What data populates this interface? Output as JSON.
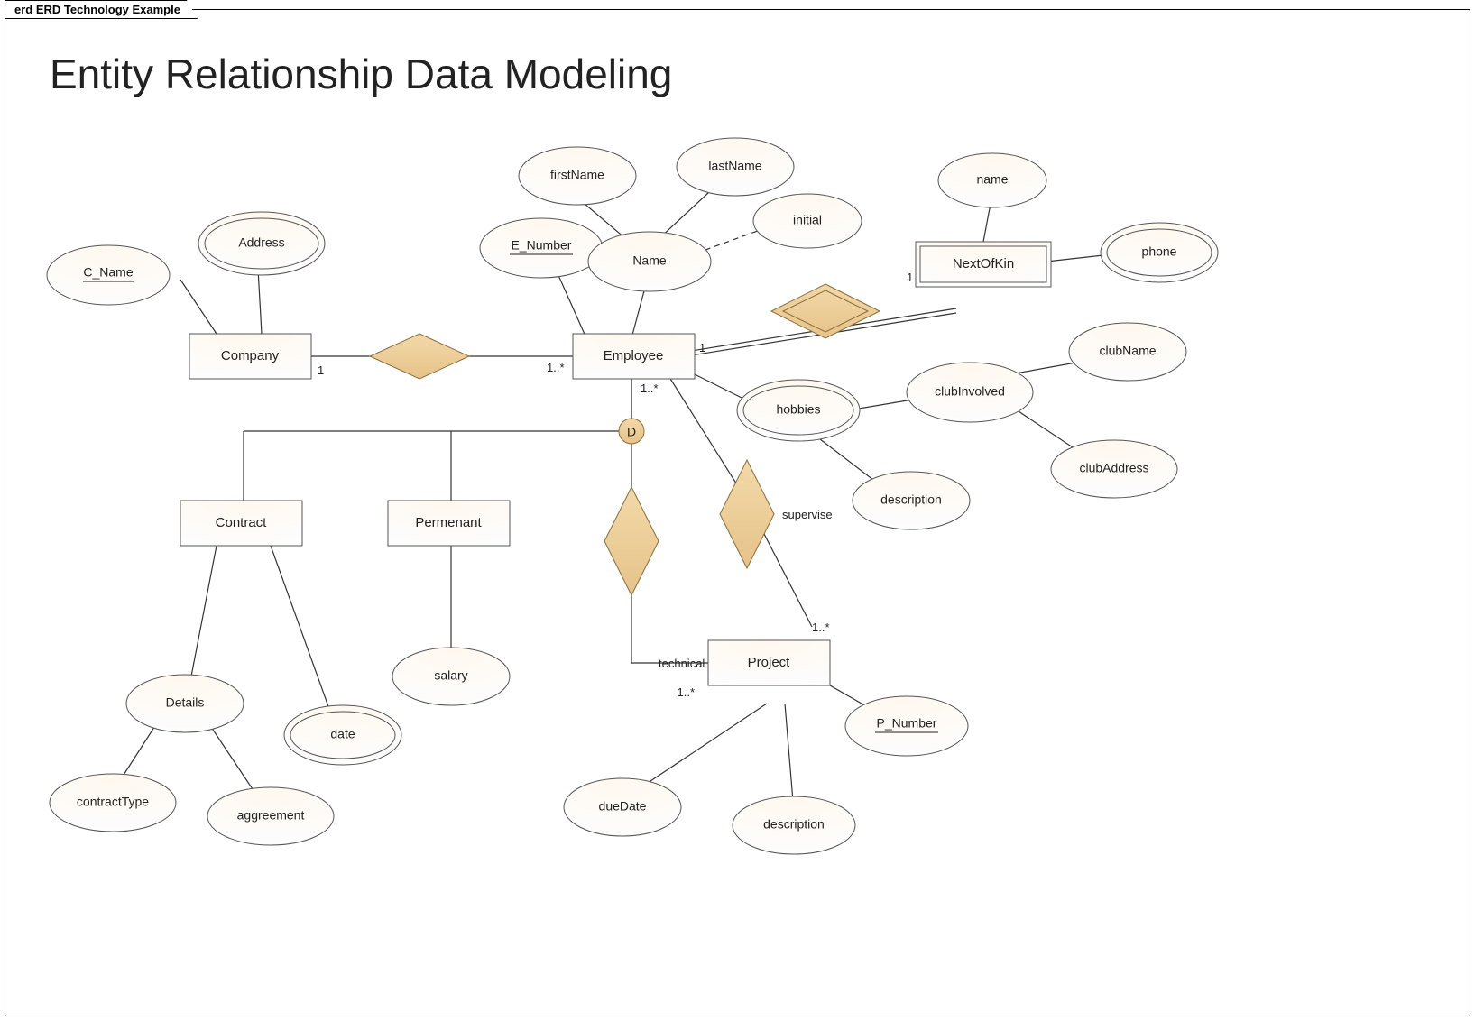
{
  "tab": "erd ERD Technology Example",
  "title": "Entity Relationship Data Modeling",
  "entities": {
    "company": "Company",
    "employee": "Employee",
    "nextofkin": "NextOfKin",
    "contract": "Contract",
    "permanent": "Permenant",
    "project": "Project"
  },
  "attributes": {
    "c_name": "C_Name",
    "address": "Address",
    "e_number": "E_Number",
    "firstName": "firstName",
    "lastName": "lastName",
    "initial": "initial",
    "name_comp": "Name",
    "nok_name": "name",
    "nok_phone": "phone",
    "hobbies": "hobbies",
    "clubInvolved": "clubInvolved",
    "clubName": "clubName",
    "clubAddress": "clubAddress",
    "hobby_desc": "description",
    "salary": "salary",
    "details": "Details",
    "contractType": "contractType",
    "aggreement": "aggreement",
    "date": "date",
    "p_number": "P_Number",
    "dueDate": "dueDate",
    "proj_desc": "description"
  },
  "relationships": {
    "supervise": "supervise",
    "technical": "technical"
  },
  "disjoint": "D",
  "cardinalities": {
    "company_side": "1",
    "employee_company_side": "1..*",
    "employee_nok_side": "1",
    "nok_side": "1",
    "employee_project_side": "1..*",
    "project_tech_side": "1..*",
    "project_sup_side": "1..*"
  },
  "chart_data": {
    "type": "erd",
    "title": "Entity Relationship Data Modeling",
    "entities": [
      {
        "name": "Company",
        "weak": false,
        "attributes": [
          {
            "name": "C_Name",
            "key": true
          },
          {
            "name": "Address",
            "multivalued": true
          }
        ]
      },
      {
        "name": "Employee",
        "weak": false,
        "attributes": [
          {
            "name": "E_Number",
            "key": true
          },
          {
            "name": "Name",
            "composite": [
              "firstName",
              "lastName",
              "initial"
            ]
          },
          {
            "name": "hobbies",
            "multivalued": true,
            "sub": [
              "description"
            ]
          },
          {
            "name": "clubInvolved",
            "sub": [
              "clubName",
              "clubAddress"
            ]
          }
        ]
      },
      {
        "name": "NextOfKin",
        "weak": true,
        "attributes": [
          {
            "name": "name"
          },
          {
            "name": "phone",
            "multivalued": true
          }
        ]
      },
      {
        "name": "Contract",
        "supertype": "Employee",
        "attributes": [
          {
            "name": "Details",
            "sub": [
              "contractType",
              "aggreement"
            ]
          },
          {
            "name": "date",
            "multivalued": true
          }
        ]
      },
      {
        "name": "Permenant",
        "supertype": "Employee",
        "attributes": [
          {
            "name": "salary"
          }
        ]
      },
      {
        "name": "Project",
        "weak": false,
        "attributes": [
          {
            "name": "P_Number",
            "key": true
          },
          {
            "name": "dueDate"
          },
          {
            "name": "description"
          }
        ]
      }
    ],
    "relationships": [
      {
        "name": "",
        "between": [
          "Company",
          "Employee"
        ],
        "card": [
          "1",
          "1..*"
        ]
      },
      {
        "name": "",
        "identifying": true,
        "between": [
          "Employee",
          "NextOfKin"
        ],
        "card": [
          "1",
          "1"
        ]
      },
      {
        "name": "technical",
        "between": [
          "Employee",
          "Project"
        ],
        "card": [
          "1..*",
          "1..*"
        ]
      },
      {
        "name": "supervise",
        "between": [
          "Employee",
          "Project"
        ],
        "card": [
          "1..*",
          "1..*"
        ]
      }
    ],
    "specialization": {
      "supertype": "Employee",
      "subtypes": [
        "Contract",
        "Permenant"
      ],
      "constraint": "D"
    }
  }
}
